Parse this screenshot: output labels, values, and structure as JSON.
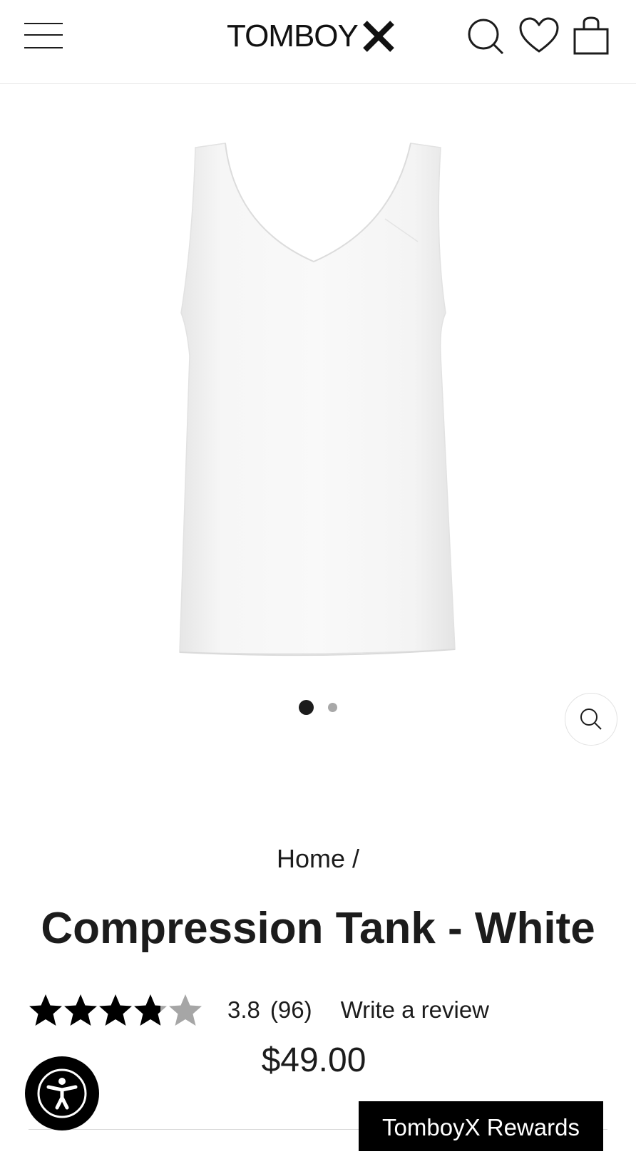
{
  "header": {
    "logo_text": "TOMBOY",
    "icons": [
      "menu-icon",
      "search-icon",
      "heart-icon",
      "shopping-bag-icon"
    ]
  },
  "gallery": {
    "image_alt": "White compression tank top",
    "dots_total": 2,
    "active_dot": 1
  },
  "breadcrumb": {
    "home_label": "Home",
    "separator": "/"
  },
  "product": {
    "title": "Compression Tank - White",
    "rating": {
      "stars_value": 3.8,
      "stars_max": 5,
      "value_text": "3.8",
      "count_text": "(96)",
      "write_review_label": "Write a review"
    },
    "price": "$49.00"
  },
  "floating": {
    "rewards_label": "TomboyX Rewards"
  },
  "colors": {
    "text": "#1c1c1c",
    "star_filled": "#000000",
    "star_empty": "#a6a6a6",
    "button_bg": "#000000"
  }
}
